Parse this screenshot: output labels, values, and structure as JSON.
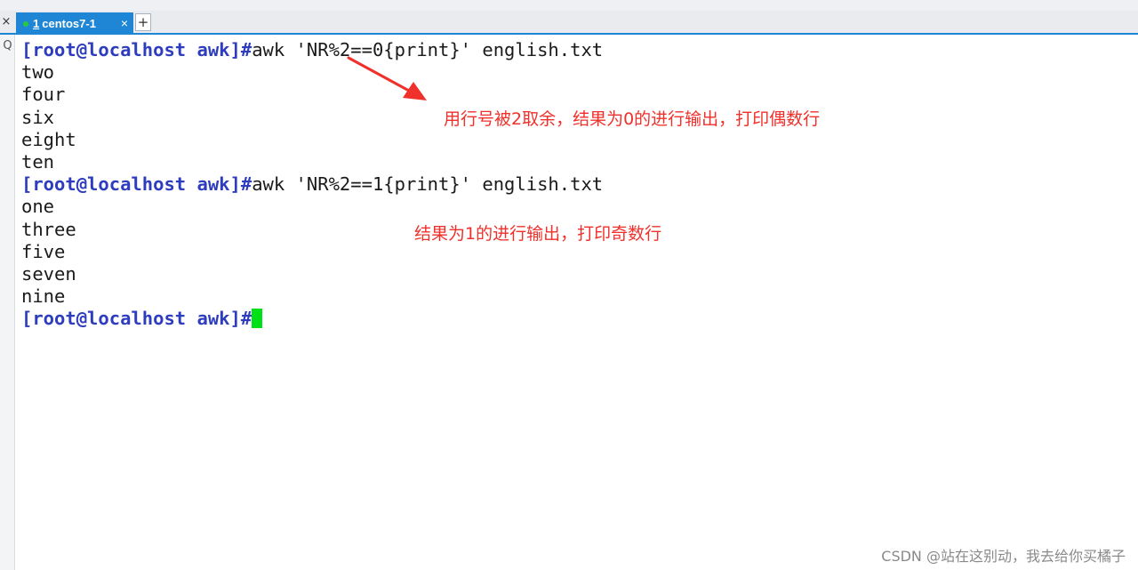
{
  "window": {
    "close_glyph": "×",
    "tab": {
      "number": "1",
      "label": "centos7-1",
      "close_glyph": "×",
      "status_color": "#27c93f"
    },
    "new_tab_glyph": "+",
    "search_icon_glyph": "Q"
  },
  "terminal": {
    "prompt": "[root@localhost awk]#",
    "command_1": "awk 'NR%2==0{print}' english.txt",
    "output_1": [
      "two",
      "four",
      "six",
      "eight",
      "ten"
    ],
    "command_2": "awk 'NR%2==1{print}' english.txt",
    "output_2": [
      "one",
      "three",
      "five",
      "seven",
      "nine"
    ],
    "cursor_color": "#00e016"
  },
  "annotations": {
    "note_1": "用行号被2取余，结果为0的进行输出，打印偶数行",
    "note_2": "结果为1的进行输出，打印奇数行",
    "color": "#f0302a"
  },
  "watermark": "CSDN @站在这别动，我去给你买橘子"
}
